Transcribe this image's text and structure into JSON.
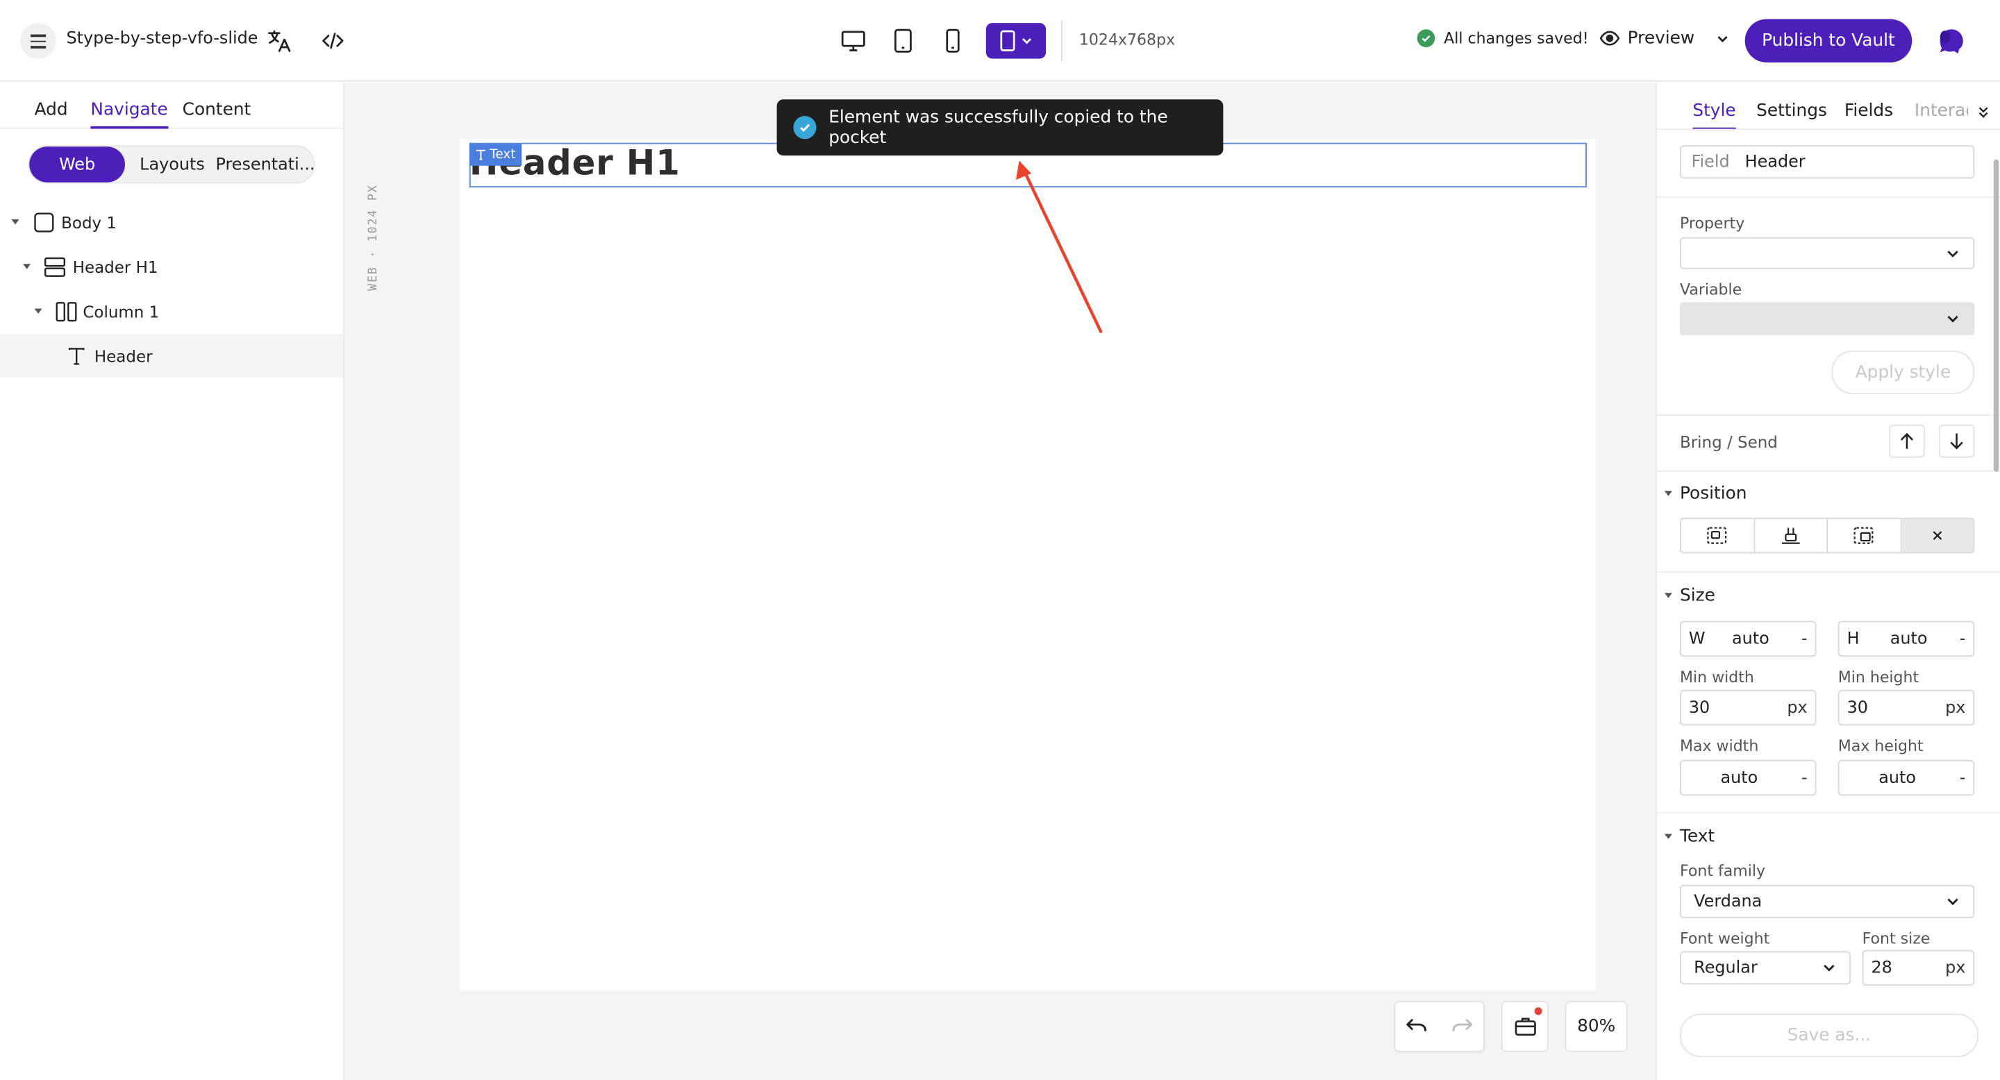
{
  "topbar": {
    "doc_title": "Stype-by-step-vfo-slide",
    "dimensions": "1024x768px",
    "status": "All changes saved!",
    "preview_label": "Preview",
    "publish_label": "Publish to Vault"
  },
  "left_panel": {
    "tabs": [
      {
        "label": "Add"
      },
      {
        "label": "Navigate",
        "active": true
      },
      {
        "label": "Content"
      }
    ],
    "segments": [
      {
        "label": "Web",
        "active": true
      },
      {
        "label": "Layouts"
      },
      {
        "label": "Presentati..."
      }
    ],
    "tree": [
      {
        "label": "Body 1",
        "icon": "body-icon"
      },
      {
        "label": "Header H1",
        "icon": "section-icon"
      },
      {
        "label": "Column 1",
        "icon": "columns-icon"
      },
      {
        "label": "Header",
        "icon": "text-icon",
        "selected": true
      }
    ]
  },
  "canvas": {
    "vertical_label": "WEB · 1024 PX",
    "selected_tag": "Text",
    "header_text": "Header H1",
    "toast": "Element was successfully copied to the pocket",
    "zoom": "80%"
  },
  "right_panel": {
    "tabs": [
      {
        "label": "Style",
        "active": true
      },
      {
        "label": "Settings"
      },
      {
        "label": "Fields"
      },
      {
        "label": "Interac"
      }
    ],
    "field_label": "Field",
    "field_value": "Header",
    "property_label": "Property",
    "variable_label": "Variable",
    "apply_style": "Apply style",
    "bring_send": "Bring / Send",
    "position_title": "Position",
    "size_title": "Size",
    "w_label": "W",
    "w_value": "auto",
    "h_label": "H",
    "h_value": "auto",
    "dash": "-",
    "min_width_label": "Min width",
    "min_width_value": "30",
    "min_height_label": "Min height",
    "min_height_value": "30",
    "max_width_label": "Max width",
    "max_width_value": "auto",
    "max_height_label": "Max height",
    "max_height_value": "auto",
    "unit": "px",
    "text_title": "Text",
    "font_family_label": "Font family",
    "font_family_value": "Verdana",
    "font_weight_label": "Font weight",
    "font_weight_value": "Regular",
    "font_size_label": "Font size",
    "font_size_value": "28",
    "save_as": "Save as..."
  },
  "colors": {
    "accent": "#4b1fb8",
    "selection": "#4a7fe0",
    "success": "#3b9b5a",
    "toast_bg": "#1f1f1f",
    "annotation_arrow": "#e8432f"
  }
}
